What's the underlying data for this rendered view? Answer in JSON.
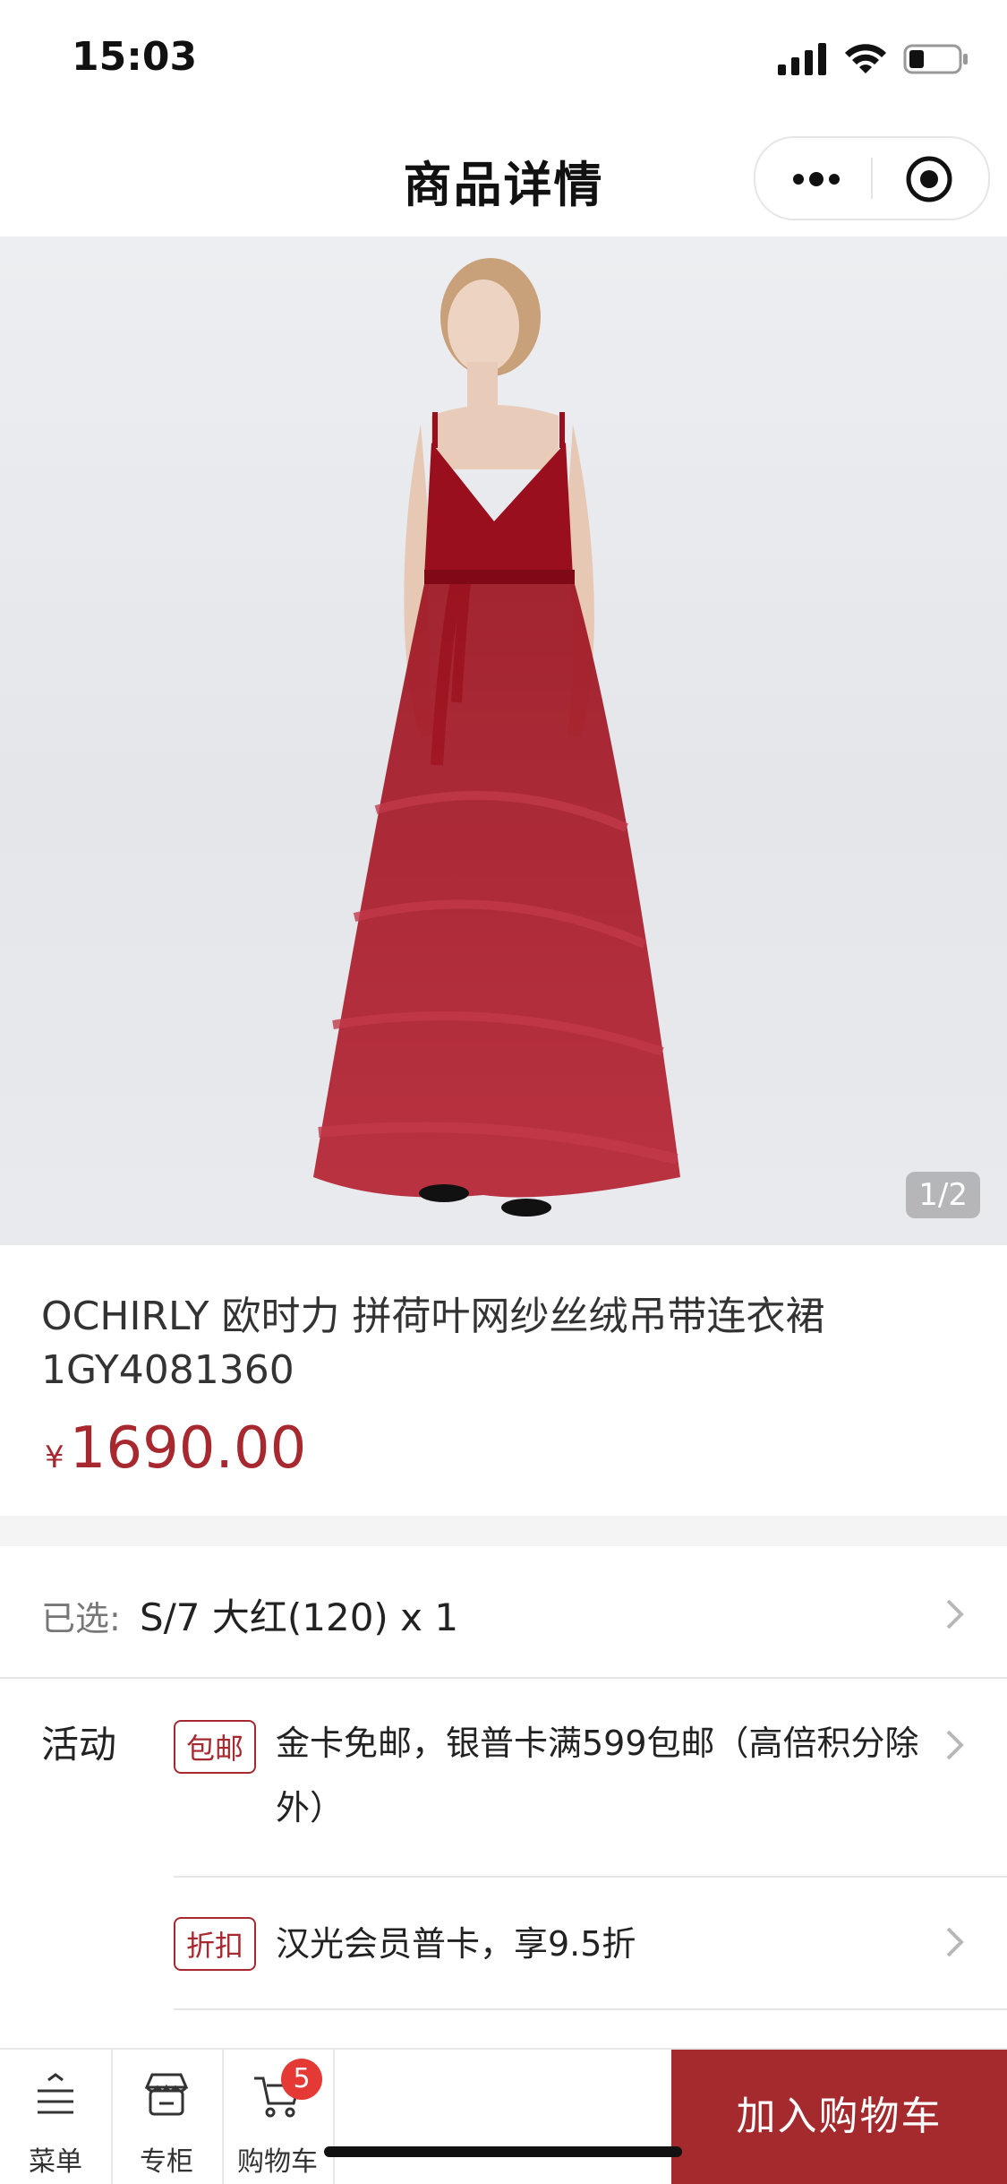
{
  "status": {
    "time": "15:03"
  },
  "nav": {
    "title": "商品详情"
  },
  "gallery": {
    "counter": "1/2"
  },
  "product": {
    "title": "OCHIRLY 欧时力 拼荷叶网纱丝绒吊带连衣裙 1GY4081360",
    "currency": "¥",
    "price": "1690.00"
  },
  "selection": {
    "label": "已选:",
    "value": "S/7 大红(120) x 1"
  },
  "activities": {
    "label": "活动",
    "items": [
      {
        "tag": "包邮",
        "text": "金卡免邮，银普卡满599包邮（高倍积分除外）"
      },
      {
        "tag": "折扣",
        "text": "汉光会员普卡，享9.5折"
      }
    ]
  },
  "tabbar": {
    "menu_label": "菜单",
    "counter_label": "专柜",
    "cart_label": "购物车",
    "cart_count": "5",
    "add_to_cart": "加入购物车"
  },
  "colors": {
    "accent": "#a42a2e",
    "price": "#a8282f",
    "badge": "#e53935"
  }
}
